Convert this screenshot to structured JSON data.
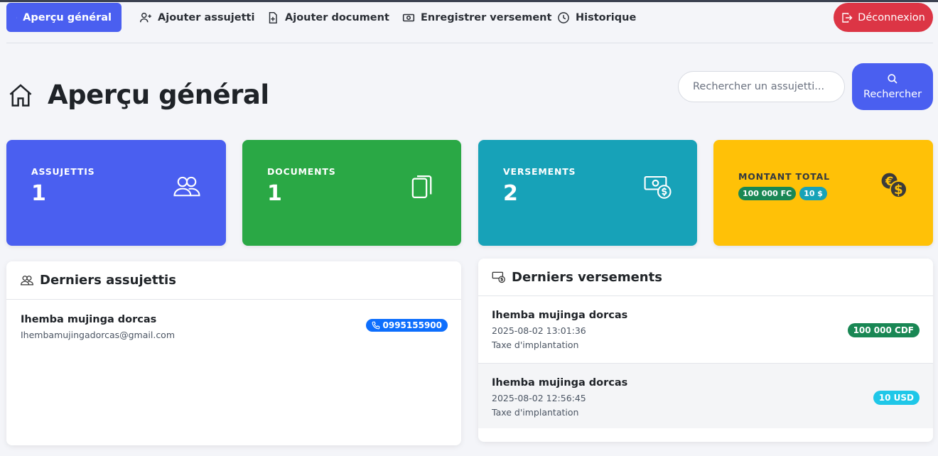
{
  "nav": {
    "items": [
      {
        "label": "Aperçu général",
        "icon": "home-icon",
        "active": true
      },
      {
        "label": "Ajouter assujetti",
        "icon": "user-plus-icon"
      },
      {
        "label": "Ajouter document",
        "icon": "file-plus-icon"
      },
      {
        "label": "Enregistrer versement",
        "icon": "cash-icon"
      },
      {
        "label": "Historique",
        "icon": "clock-icon"
      }
    ],
    "logout_label": "Déconnexion"
  },
  "header": {
    "title": "Aperçu général",
    "search_placeholder": "Rechercher un assujetti...",
    "search_button": "Rechercher"
  },
  "stats": [
    {
      "label": "ASSUJETTIS",
      "value": "1",
      "icon": "people-icon",
      "color": "#4a5ff0"
    },
    {
      "label": "DOCUMENTS",
      "value": "1",
      "icon": "files-icon",
      "color": "#2aa845"
    },
    {
      "label": "VERSEMENTS",
      "value": "2",
      "icon": "cash-stack-icon",
      "color": "#17a2b8"
    },
    {
      "label": "MONTANT TOTAL",
      "badges": [
        "100 000 FC",
        "10 $"
      ],
      "icon": "coins-icon",
      "color": "#ffc107"
    }
  ],
  "recent_taxpayers": {
    "title": "Derniers assujettis",
    "items": [
      {
        "name": "Ihemba mujinga dorcas",
        "email": "Ihembamujingadorcas@gmail.com",
        "phone": "0995155900"
      }
    ]
  },
  "recent_payments": {
    "title": "Derniers versements",
    "items": [
      {
        "name": "Ihemba mujinga dorcas",
        "date": "2025-08-02 13:01:36",
        "description": "Taxe d'implantation",
        "amount": "100 000 CDF",
        "color": "#198754"
      },
      {
        "name": "Ihemba mujinga dorcas",
        "date": "2025-08-02 12:56:45",
        "description": "Taxe d'implantation",
        "amount": "10 USD",
        "color": "#1fc7e8"
      }
    ]
  }
}
